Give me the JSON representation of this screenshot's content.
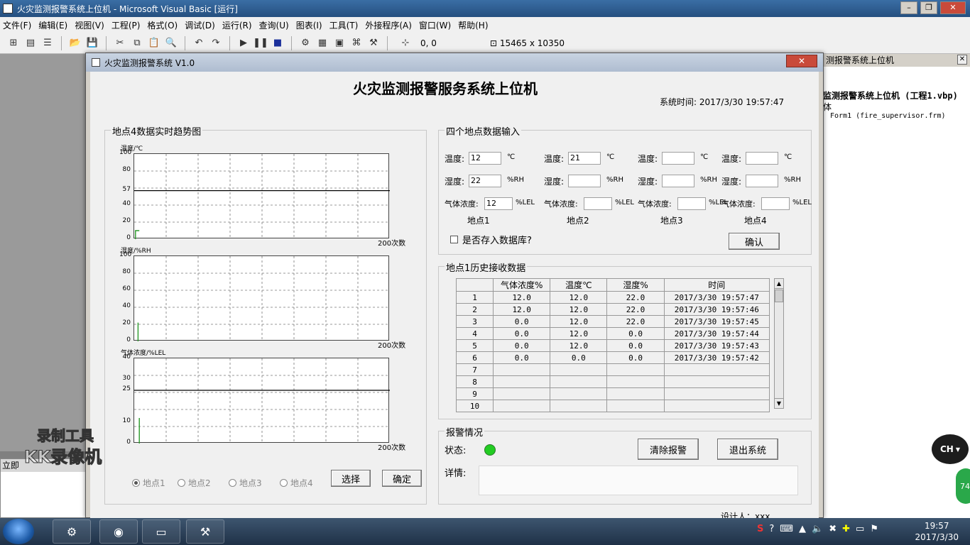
{
  "ide": {
    "title": "火灾监测报警系统上位机 - Microsoft Visual Basic [运行]",
    "menu": [
      "文件(F)",
      "编辑(E)",
      "视图(V)",
      "工程(P)",
      "格式(O)",
      "调试(D)",
      "运行(R)",
      "查询(U)",
      "图表(I)",
      "工具(T)",
      "外接程序(A)",
      "窗口(W)",
      "帮助(H)"
    ],
    "coords": "0, 0",
    "size": "15465 x 10350",
    "immediate_title": "立即",
    "project_header": "测报警系统上位机",
    "project_line1": "监测报警系统上位机 (工程1.vbp)",
    "project_line2": "体",
    "project_line3": "Form1 (fire_supervisor.frm)"
  },
  "form": {
    "window_title": "火灾监测报警系统 V1.0",
    "heading": "火灾监测报警服务系统上位机",
    "system_time": "系统时间: 2017/3/30 19:57:47",
    "designer": "设计人：xxx"
  },
  "trend": {
    "group_title": "地点4数据实时趋势图",
    "x_end_label": "200次数",
    "charts": [
      {
        "ylabel": "温度/℃",
        "ticks": [
          "100",
          "80",
          "57",
          "40",
          "20",
          "0"
        ],
        "tick_values": [
          100,
          80,
          57,
          40,
          20,
          0
        ],
        "ymin": 0,
        "ymax": 100,
        "hline": 57,
        "spike": [
          [
            1,
            0
          ],
          [
            1,
            10
          ],
          [
            4,
            10
          ]
        ]
      },
      {
        "ylabel": "湿度/%RH",
        "ticks": [
          "100",
          "80",
          "60",
          "40",
          "20",
          "0"
        ],
        "tick_values": [
          100,
          80,
          60,
          40,
          20,
          0
        ],
        "ymin": 0,
        "ymax": 100,
        "hline": null,
        "spike": [
          [
            3,
            0
          ],
          [
            3,
            22
          ]
        ]
      },
      {
        "ylabel": "气体浓度/%LEL",
        "ticks": [
          "40",
          "30",
          "25",
          "10",
          "0"
        ],
        "tick_values": [
          40,
          30,
          25,
          10,
          0
        ],
        "ymin": 0,
        "ymax": 40,
        "hline": 25,
        "spike": [
          [
            4,
            0
          ],
          [
            4,
            12
          ]
        ]
      }
    ],
    "radios": [
      "地点1",
      "地点2",
      "地点3",
      "地点4"
    ],
    "selected_radio": 0,
    "select_button": "选择",
    "confirm_button": "确定"
  },
  "input": {
    "group_title": "四个地点数据输入",
    "temp_label": "温度:",
    "temp_unit": "℃",
    "humid_label": "湿度:",
    "humid_unit": "%RH",
    "gas_label": "气体浓度:",
    "gas_unit": "%LEL",
    "sites": [
      {
        "name": "地点1",
        "temp": "12",
        "humid": "22",
        "gas": "12"
      },
      {
        "name": "地点2",
        "temp": "21",
        "humid": "",
        "gas": ""
      },
      {
        "name": "地点3",
        "temp": "",
        "humid": "",
        "gas": ""
      },
      {
        "name": "地点4",
        "temp": "",
        "humid": "",
        "gas": ""
      }
    ],
    "save_db_label": "是否存入数据库?",
    "ok_button": "确认"
  },
  "history": {
    "group_title": "地点1历史接收数据",
    "columns": [
      "",
      "气体浓度%",
      "温度℃",
      "湿度%",
      "时间"
    ],
    "rows": [
      [
        "1",
        "12.0",
        "12.0",
        "22.0",
        "2017/3/30 19:57:47"
      ],
      [
        "2",
        "12.0",
        "12.0",
        "22.0",
        "2017/3/30 19:57:46"
      ],
      [
        "3",
        "0.0",
        "12.0",
        "22.0",
        "2017/3/30 19:57:45"
      ],
      [
        "4",
        "0.0",
        "12.0",
        "0.0",
        "2017/3/30 19:57:44"
      ],
      [
        "5",
        "0.0",
        "12.0",
        "0.0",
        "2017/3/30 19:57:43"
      ],
      [
        "6",
        "0.0",
        "0.0",
        "0.0",
        "2017/3/30 19:57:42"
      ],
      [
        "7",
        "",
        "",
        "",
        ""
      ],
      [
        "8",
        "",
        "",
        "",
        ""
      ],
      [
        "9",
        "",
        "",
        "",
        ""
      ],
      [
        "10",
        "",
        "",
        "",
        ""
      ]
    ]
  },
  "alarm": {
    "group_title": "报警情况",
    "status_label": "状态:",
    "status_color": "#22cc22",
    "clear_button": "清除报警",
    "exit_button": "退出系统",
    "detail_label": "详情:",
    "detail_text": ""
  },
  "taskbar": {
    "time": "19:57",
    "date": "2017/3/30"
  },
  "overlay": {
    "watermark_line1": "录制工具",
    "watermark_line2": "KK录像机",
    "ime_bubble": "CH",
    "badge": "74"
  }
}
